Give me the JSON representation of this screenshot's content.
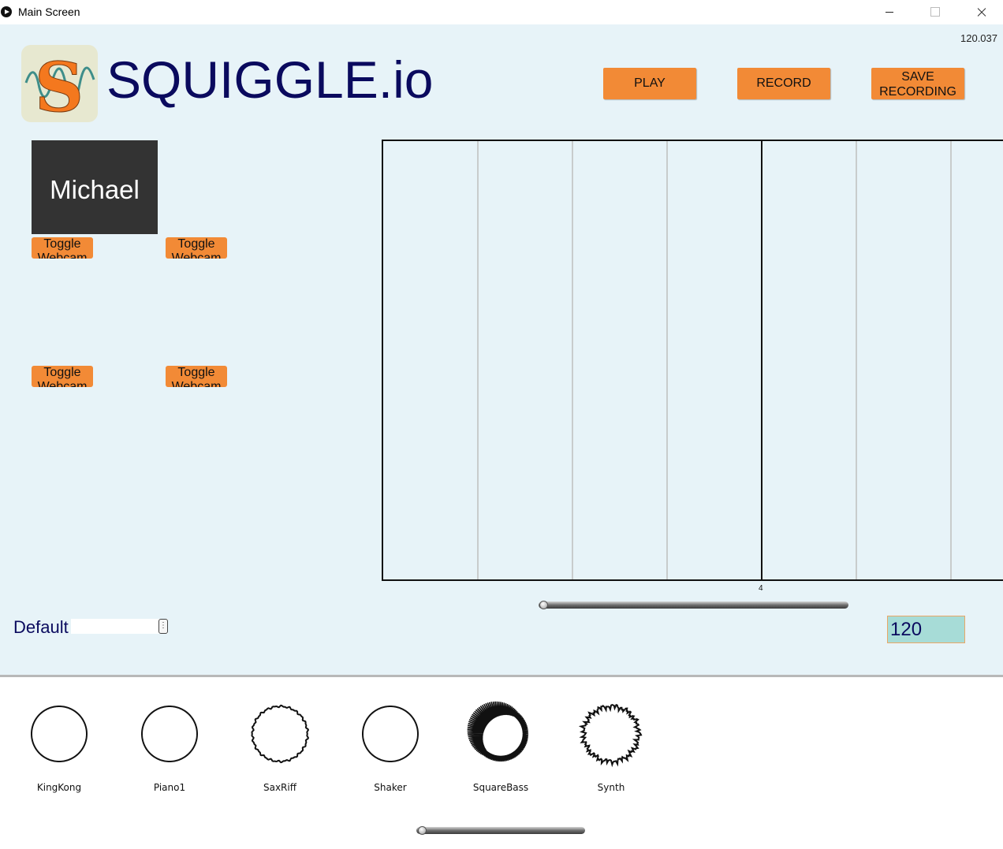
{
  "window": {
    "title": "Main Screen",
    "controls": [
      "minimize-icon",
      "maximize-icon",
      "close-icon"
    ]
  },
  "header": {
    "fps": "120.037",
    "brand": "SQUIGGLE.io",
    "logo_letter": "S",
    "play_label": "PLAY",
    "record_label": "RECORD",
    "save_label_line1": "SAVE",
    "save_label_line2": "RECORDING"
  },
  "participants": {
    "user_name": "Michael",
    "toggle_label_line1": "Toggle",
    "toggle_label_line2": "Webcam"
  },
  "timeline": {
    "beat_label": "4",
    "bar_divisions": 8,
    "scroll_position": 0
  },
  "preset": {
    "label": "Default",
    "handle_glyph": "⋮"
  },
  "tempo": {
    "bpm": "120"
  },
  "instruments": {
    "items": [
      {
        "name": "KingKong",
        "shape": "smooth"
      },
      {
        "name": "Piano1",
        "shape": "smooth"
      },
      {
        "name": "SaxRiff",
        "shape": "slight"
      },
      {
        "name": "Shaker",
        "shape": "smooth"
      },
      {
        "name": "SquareBass",
        "shape": "spiky"
      },
      {
        "name": "Synth",
        "shape": "jagged"
      }
    ],
    "scroll_position": 0
  },
  "colors": {
    "accent": "#f28a36",
    "panel": "#e7f3f8",
    "brand_text": "#0a0a5e",
    "bpm_field": "#a7dcd7"
  }
}
